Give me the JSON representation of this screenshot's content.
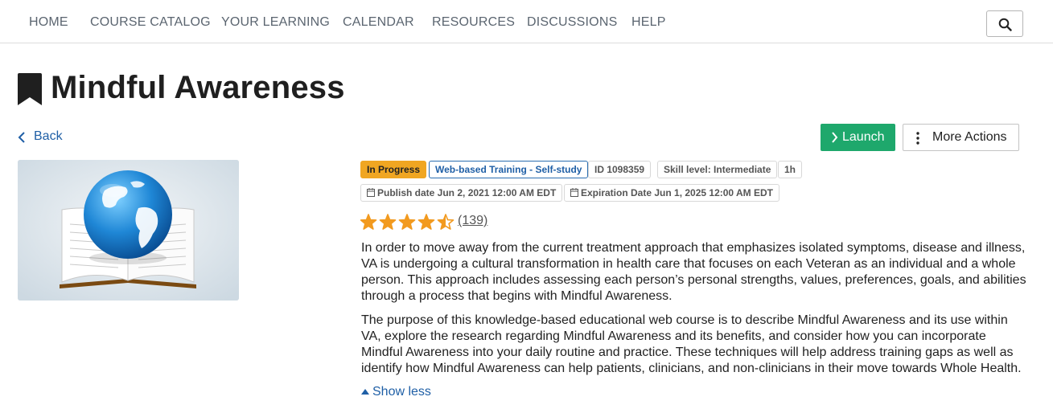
{
  "nav": {
    "items": [
      "HOME",
      "COURSE CATALOG",
      "YOUR LEARNING",
      "CALENDAR",
      "RESOURCES",
      "DISCUSSIONS",
      "HELP"
    ]
  },
  "course": {
    "title": "Mindful Awareness",
    "back_label": "Back",
    "launch_label": "Launch",
    "more_actions_label": "More Actions",
    "badges": {
      "status": "In Progress",
      "type": "Web-based Training - Self-study",
      "id": "ID 1098359",
      "skill": "Skill level: Intermediate",
      "duration": "1h",
      "publish": "Publish date Jun 2, 2021 12:00 AM EDT",
      "expiration": "Expiration Date Jun 1, 2025 12:00 AM EDT"
    },
    "rating": {
      "stars": 4.5,
      "max": 5,
      "count_label": "(139)"
    },
    "description": [
      "In order to move away from the current treatment approach that emphasizes isolated symptoms, disease and illness, VA is undergoing a cultural transformation in health care that focuses on each Veteran as an individual and a whole person. This approach includes assessing each person’s personal strengths, values, preferences, goals, and abilities through a process that begins with Mindful Awareness.",
      "The purpose of this knowledge-based educational web course is to describe Mindful Awareness and its use within VA, explore the research regarding Mindful Awareness and its benefits, and consider how you can incorporate Mindful Awareness into your daily routine and practice. These techniques will help address training gaps as well as identify how Mindful Awareness can help patients, clinicians, and non-clinicians in their move towards Whole Health."
    ],
    "show_less_label": "Show less"
  },
  "colors": {
    "accent_green": "#1ea86c",
    "link_blue": "#1f5fa6",
    "status_orange": "#f0a622",
    "star_orange": "#f29a1f"
  }
}
